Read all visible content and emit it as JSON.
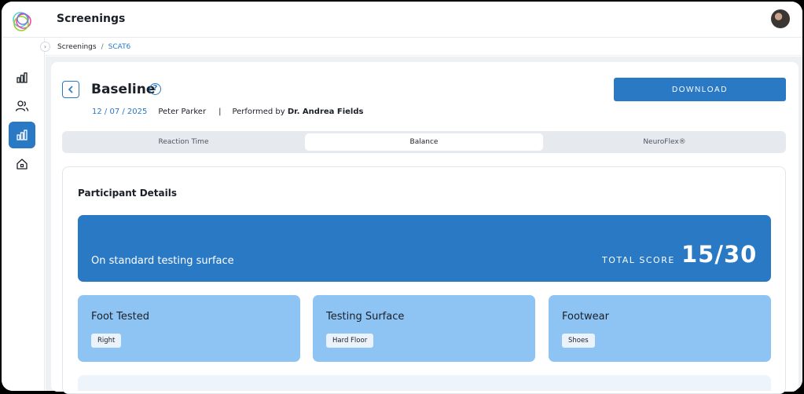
{
  "app": {
    "title": "Screenings"
  },
  "breadcrumb": {
    "root": "Screenings",
    "separator": "/",
    "current": "SCAT6"
  },
  "header": {
    "title": "Baseline",
    "help_glyph": "?",
    "date": "12 / 07 / 2025",
    "participant": "Peter Parker",
    "divider": "|",
    "performed_prefix": "Performed by",
    "performed_by": "Dr. Andrea Fields",
    "download_label": "DOWNLOAD"
  },
  "tabs": [
    {
      "label": "Reaction Time",
      "active": false
    },
    {
      "label": "Balance",
      "active": true
    },
    {
      "label": "NeuroFlex®",
      "active": false
    }
  ],
  "details": {
    "section_title": "Participant Details",
    "surface_label": "On standard testing surface",
    "total_label": "TOTAL SCORE",
    "total_value": "15/30",
    "cards": [
      {
        "title": "Foot Tested",
        "value": "Right"
      },
      {
        "title": "Testing Surface",
        "value": "Hard Floor"
      },
      {
        "title": "Footwear",
        "value": "Shoes"
      }
    ]
  },
  "sidebar": {
    "items": [
      {
        "icon": "bar-chart-icon",
        "active": false
      },
      {
        "icon": "users-icon",
        "active": false
      },
      {
        "icon": "bar-chart-icon",
        "active": true
      },
      {
        "icon": "home-icon",
        "active": false
      }
    ],
    "toggle_glyph": "›"
  },
  "colors": {
    "accent": "#2a79c4",
    "card": "#8ec4f4",
    "surface": "#eef1f4"
  }
}
